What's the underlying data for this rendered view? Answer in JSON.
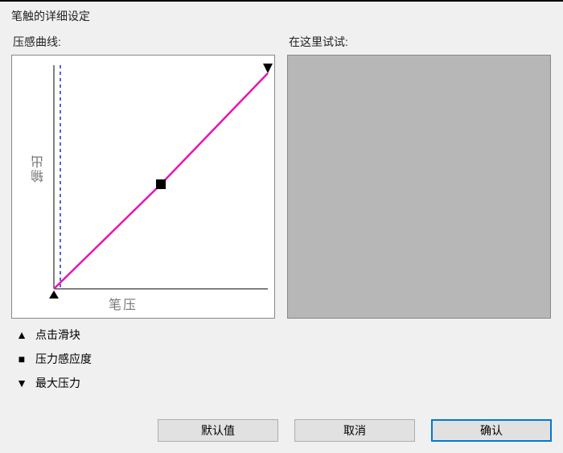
{
  "window": {
    "title": "笔触的详细设定"
  },
  "labels": {
    "curve_section": "压感曲线:",
    "test_section": "在这里试试:",
    "y_axis": "输出",
    "x_axis": "笔压"
  },
  "legend": {
    "click_slider": "点击滑块",
    "pressure_sensitivity": "压力感应度",
    "max_pressure": "最大压力"
  },
  "buttons": {
    "default": "默认值",
    "cancel": "取消",
    "ok": "确认"
  },
  "chart_data": {
    "type": "line",
    "title": "压感曲线",
    "xlabel": "笔压",
    "ylabel": "输出",
    "xlim": [
      0,
      100
    ],
    "ylim": [
      0,
      100
    ],
    "series": [
      {
        "name": "curve",
        "x": [
          0,
          50,
          100
        ],
        "y": [
          0,
          47,
          96
        ]
      }
    ],
    "markers": {
      "click_slider": {
        "axis": "x",
        "value": 0,
        "symbol": "triangle-up"
      },
      "pressure_sensitivity": {
        "x": 50,
        "y": 47,
        "symbol": "square"
      },
      "max_pressure": {
        "axis": "x",
        "value": 100,
        "symbol": "triangle-down"
      }
    },
    "threshold_line": {
      "axis": "x",
      "value": 3,
      "style": "dashed"
    }
  }
}
